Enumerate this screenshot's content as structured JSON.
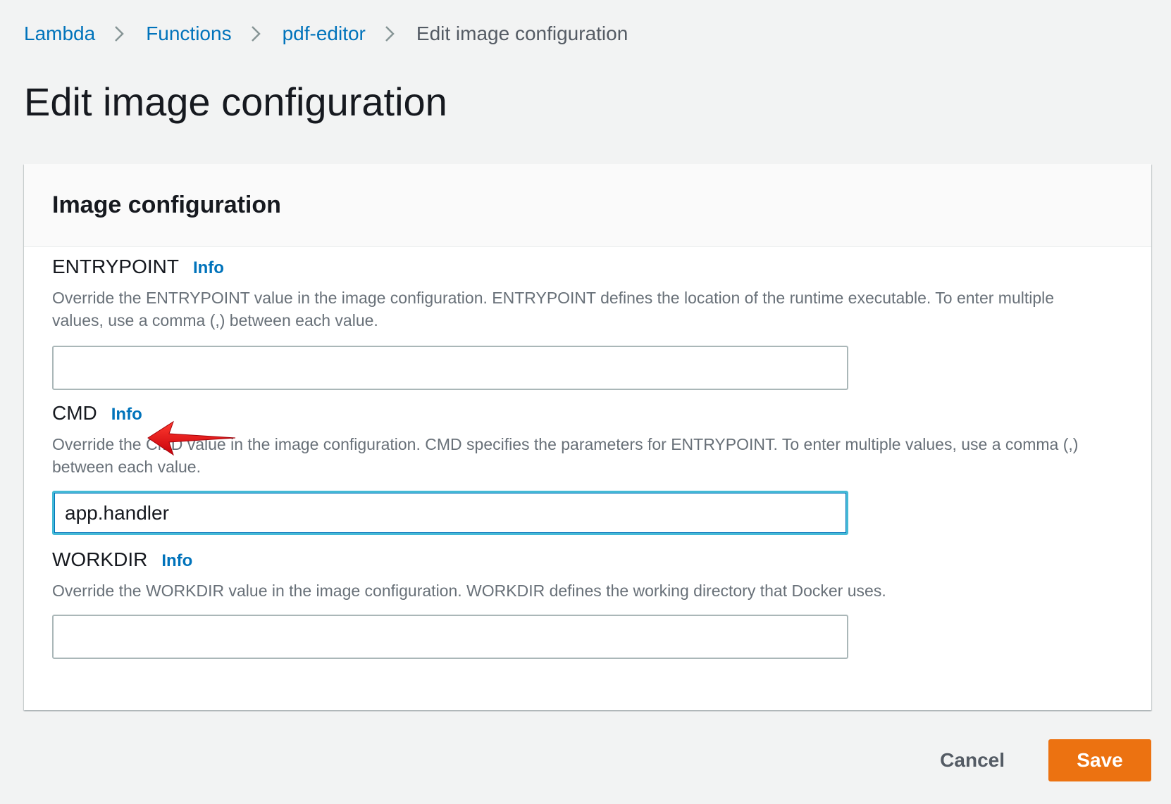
{
  "breadcrumb": {
    "items": [
      {
        "label": "Lambda"
      },
      {
        "label": "Functions"
      },
      {
        "label": "pdf-editor"
      }
    ],
    "current": "Edit image configuration"
  },
  "page": {
    "title": "Edit image configuration"
  },
  "panel": {
    "title": "Image configuration"
  },
  "fields": {
    "entrypoint": {
      "label": "ENTRYPOINT",
      "info": "Info",
      "description": "Override the ENTRYPOINT value in the image configuration. ENTRYPOINT defines the location of the runtime executable. To enter multiple values, use a comma (,) between each value.",
      "value": ""
    },
    "cmd": {
      "label": "CMD",
      "info": "Info",
      "description": "Override the CMD value in the image configuration. CMD specifies the parameters for ENTRYPOINT. To enter multiple values, use a comma (,) between each value.",
      "value": "app.handler"
    },
    "workdir": {
      "label": "WORKDIR",
      "info": "Info",
      "description": "Override the WORKDIR value in the image configuration. WORKDIR defines the working directory that Docker uses.",
      "value": ""
    }
  },
  "actions": {
    "cancel": "Cancel",
    "save": "Save"
  },
  "colors": {
    "link": "#0073bb",
    "primary_button": "#ec7211",
    "focus_border": "#44b9d6",
    "annotation_arrow": "#e0000f"
  },
  "icons": {
    "breadcrumb_separator": "chevron-right-icon",
    "annotation": "red-arrow-icon"
  }
}
